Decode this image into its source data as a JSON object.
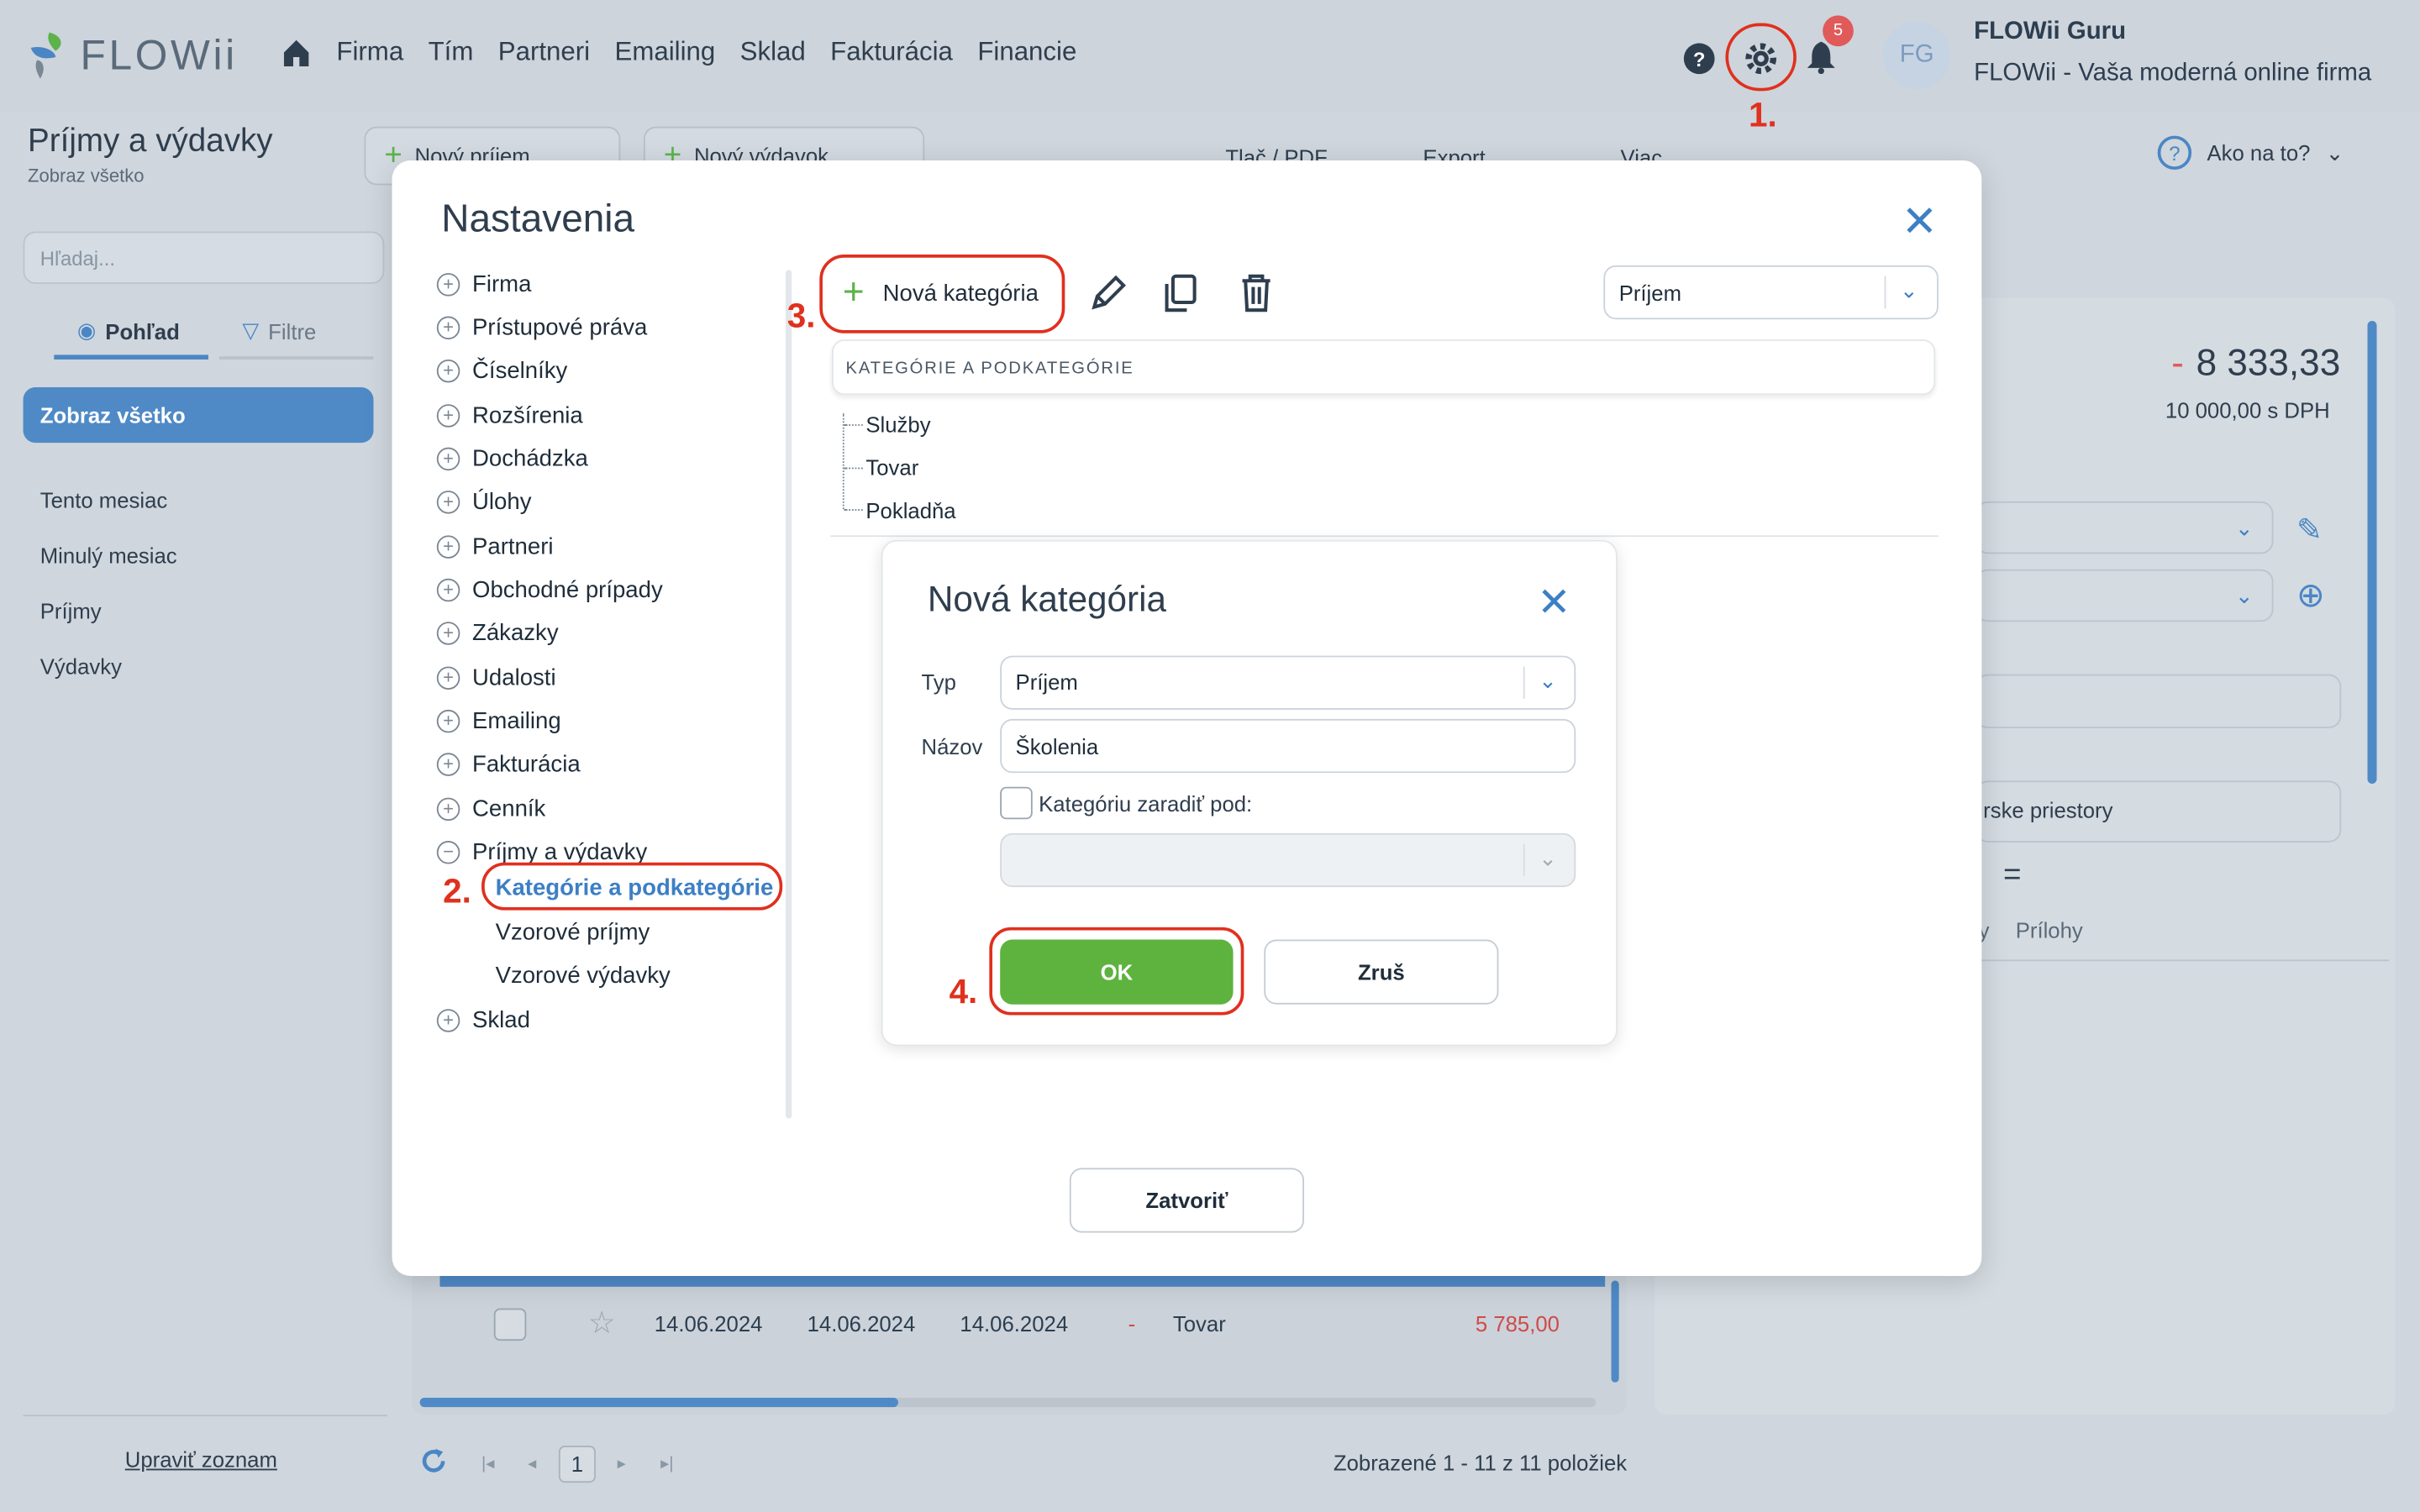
{
  "app": {
    "logo_text": "FLOWii",
    "nav": [
      "Firma",
      "Tím",
      "Partneri",
      "Emailing",
      "Sklad",
      "Fakturácia",
      "Financie"
    ],
    "notification_count": "5",
    "avatar_initials": "FG",
    "user_name": "FLOWii Guru",
    "user_company": "FLOWii - Vaša moderná online firma"
  },
  "page": {
    "title": "Príjmy a výdavky",
    "subtitle": "Zobraz všetko",
    "toolbar": [
      "Nový príjem",
      "Nový výdavok",
      "Tlač / PDF",
      "Export",
      "Viac"
    ],
    "help_label": "Ako na to?"
  },
  "sidebar": {
    "search_placeholder": "Hľadaj...",
    "view_tab": "Pohľad",
    "filter_tab": "Filtre",
    "show_all": "Zobraz všetko",
    "items": [
      "Tento mesiac",
      "Minulý mesiac",
      "Príjmy",
      "Výdavky"
    ],
    "edit_list": "Upraviť zoznam"
  },
  "background": {
    "row": {
      "date1": "14.06.2024",
      "date2": "14.06.2024",
      "date3": "14.06.2024",
      "dash": "-",
      "category": "Tovar",
      "amount": "5 785,00"
    },
    "pager_page": "1",
    "pager_summary": "Zobrazené 1 - 11 z 11 položiek",
    "amount_minus": "-",
    "amount_big": "8 333,33",
    "amount_small": "10 000,00 s DPH",
    "right_text": "rske priestory",
    "tab_frag": "y",
    "tab_attachments": "Prílohy"
  },
  "settings": {
    "title": "Nastavenia",
    "tree": [
      "Firma",
      "Prístupové práva",
      "Číselníky",
      "Rozšírenia",
      "Dochádzka",
      "Úlohy",
      "Partneri",
      "Obchodné prípady",
      "Zákazky",
      "Udalosti",
      "Emailing",
      "Fakturácia",
      "Cenník",
      "Príjmy a výdavky"
    ],
    "tree_sub": [
      "Kategórie a podkategórie",
      "Vzorové príjmy",
      "Vzorové výdavky"
    ],
    "tree_last": "Sklad",
    "new_category_button": "Nová kategória",
    "type_select": "Príjem",
    "cat_header": "KATEGÓRIE A PODKATEGÓRIE",
    "categories": [
      "Služby",
      "Tovar",
      "Pokladňa"
    ],
    "close_button": "Zatvoriť"
  },
  "new_category_dialog": {
    "title": "Nová kategória",
    "type_label": "Typ",
    "type_value": "Príjem",
    "name_label": "Názov",
    "name_value": "Školenia",
    "checkbox_label": "Kategóriu zaradiť pod:",
    "ok": "OK",
    "cancel": "Zruš"
  },
  "annotations": [
    "1.",
    "2.",
    "3.",
    "4."
  ],
  "colors": {
    "accent": "#3d7fc5",
    "ok_green": "#5db33e",
    "annotation_red": "#e0301e",
    "badge_red": "#e05a5a"
  }
}
